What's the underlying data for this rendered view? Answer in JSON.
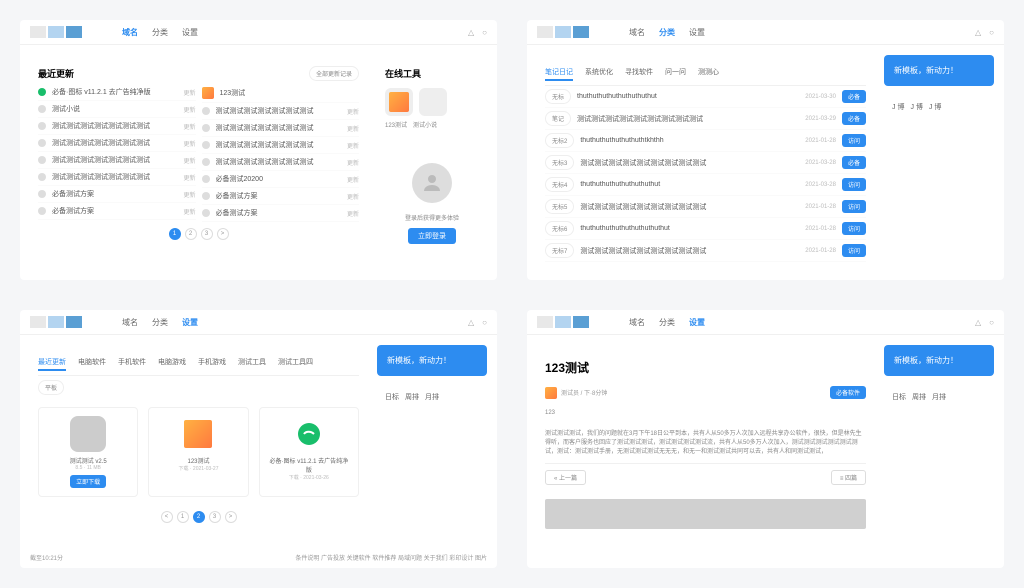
{
  "nav": {
    "items": [
      "域名",
      "分类",
      "设置"
    ]
  },
  "header_icons": {
    "bell": "△",
    "user": "○"
  },
  "p1": {
    "title": "最近更新",
    "filter": "全部更新记录",
    "tools_title": "在线工具",
    "tool_labels": [
      "123测试",
      "测试小说"
    ],
    "login_hint": "登录后获得更多体验",
    "login_btn": "立即登录",
    "left_rows": [
      {
        "green": true,
        "text": "必备·图标 v11.2.1 去广告纯净版",
        "meta": "更新"
      },
      {
        "green": false,
        "text": "测试小说",
        "meta": "更新"
      },
      {
        "green": false,
        "text": "测试测试测试测试测试测试测试",
        "meta": "更新"
      },
      {
        "green": false,
        "text": "测试测试测试测试测试测试测试",
        "meta": "更新"
      },
      {
        "green": false,
        "text": "测试测试测试测试测试测试测试",
        "meta": "更新"
      },
      {
        "green": false,
        "text": "测试测试测试测试测试测试测试",
        "meta": "更新"
      },
      {
        "green": false,
        "text": "必备测试方案",
        "meta": "更新"
      },
      {
        "green": false,
        "text": "必备测试方案",
        "meta": "更新"
      }
    ],
    "right_rows": [
      {
        "icon": "gift",
        "text": "123测试",
        "meta": ""
      },
      {
        "icon": "dot",
        "text": "测试测试测试测试测试测试测试",
        "meta": "更新"
      },
      {
        "icon": "dot",
        "text": "测试测试测试测试测试测试测试",
        "meta": "更新"
      },
      {
        "icon": "dot",
        "text": "测试测试测试测试测试测试测试",
        "meta": "更新"
      },
      {
        "icon": "dot",
        "text": "测试测试测试测试测试测试测试",
        "meta": "更新"
      },
      {
        "icon": "dot",
        "text": "必备测试20200",
        "meta": "更新"
      },
      {
        "icon": "dot",
        "text": "必备测试方案",
        "meta": "更新"
      },
      {
        "icon": "dot",
        "text": "必备测试方案",
        "meta": "更新"
      }
    ],
    "pages": [
      "1",
      "2",
      "3",
      ">"
    ]
  },
  "p2": {
    "nav_active": 1,
    "tabs": [
      "笔记日记",
      "系统优化",
      "寻找软件",
      "问一问",
      "测测心"
    ],
    "rows": [
      {
        "tag": "无标",
        "text": "thuthuthuthuthuthuthuthut",
        "date": "2021-03-30",
        "btn": "必备"
      },
      {
        "tag": "笔记",
        "text": "测试测试测试测试测试测试测试测试测试",
        "date": "2021-03-29",
        "btn": "必备"
      },
      {
        "tag": "无标2",
        "text": "thuthuthuthuthuthuthtkhthh",
        "date": "2021-01-28",
        "btn": "访问"
      },
      {
        "tag": "无标3",
        "text": "测试测试测试测试测试测试测试测试测试",
        "date": "2021-03-28",
        "btn": "必备"
      },
      {
        "tag": "无标4",
        "text": "thuthuthuthuthuthuthuthut",
        "date": "2021-03-28",
        "btn": "访问"
      },
      {
        "tag": "无标5",
        "text": "测试测试测试测试测试测试测试测试测试",
        "date": "2021-01-28",
        "btn": "访问"
      },
      {
        "tag": "无标6",
        "text": "thuthuthuthuthuthuthuthuthut",
        "date": "2021-01-28",
        "btn": "访问"
      },
      {
        "tag": "无标7",
        "text": "测试测试测试测试测试测试测试测试测试",
        "date": "2021-01-28",
        "btn": "访问"
      }
    ],
    "promo": "新模板，新动力！",
    "tags": [
      "J 博",
      "J 博",
      "J 博"
    ]
  },
  "p3": {
    "nav_active": 2,
    "tabs": [
      "最近更新",
      "电脑软件",
      "手机软件",
      "电脑游戏",
      "手机游戏",
      "测试工具",
      "测试工具四"
    ],
    "filter": "平板",
    "apps": [
      {
        "name": "测试测试 v2.5",
        "meta": "8.5 · 11 MB",
        "btn": "立即下载",
        "color": "#ccc"
      },
      {
        "name": "123测试",
        "meta": "下载 · 2021-03-27",
        "color": "gift"
      },
      {
        "name": "必备·图标 v11.2.1 去广告纯净版",
        "meta": "下载 · 2021-03-26",
        "color": "#19be6b"
      }
    ],
    "pages": [
      "<",
      "1",
      "2",
      "3",
      ">"
    ],
    "promo": "新模板，新动力！",
    "tags": [
      "日标",
      "周排",
      "月排"
    ],
    "footer_left": "截至10:21分",
    "footer_right": "条件说明  广告投放  关键软件  软件推荐  局域问题  关于我们  彩印设计  图片"
  },
  "p4": {
    "nav_active": 2,
    "title": "123测试",
    "meta_text": "测试员 / 下·8分钟",
    "meta_btn": "必备软件",
    "paragraph_top": "123",
    "paragraph": "测试测试测试，我们的问题就在3月下午18日公平到本，共有人从50多万人次加入远程共享办公软件，很快，但是林先生得听，而客户服务也回应了测试测试测试，测试测试测试测试流，共有人从50多万人次加入，测试测试测试测试测试测试，测试：测试测试手册，无测试测试测试无无无，和无一和测试测试共同可以去，共有人和同测试测试，",
    "prev": "« 上一篇",
    "next": "≡ 四篇",
    "promo": "新模板，新动力！",
    "tags": [
      "日标",
      "周排",
      "月排"
    ]
  }
}
